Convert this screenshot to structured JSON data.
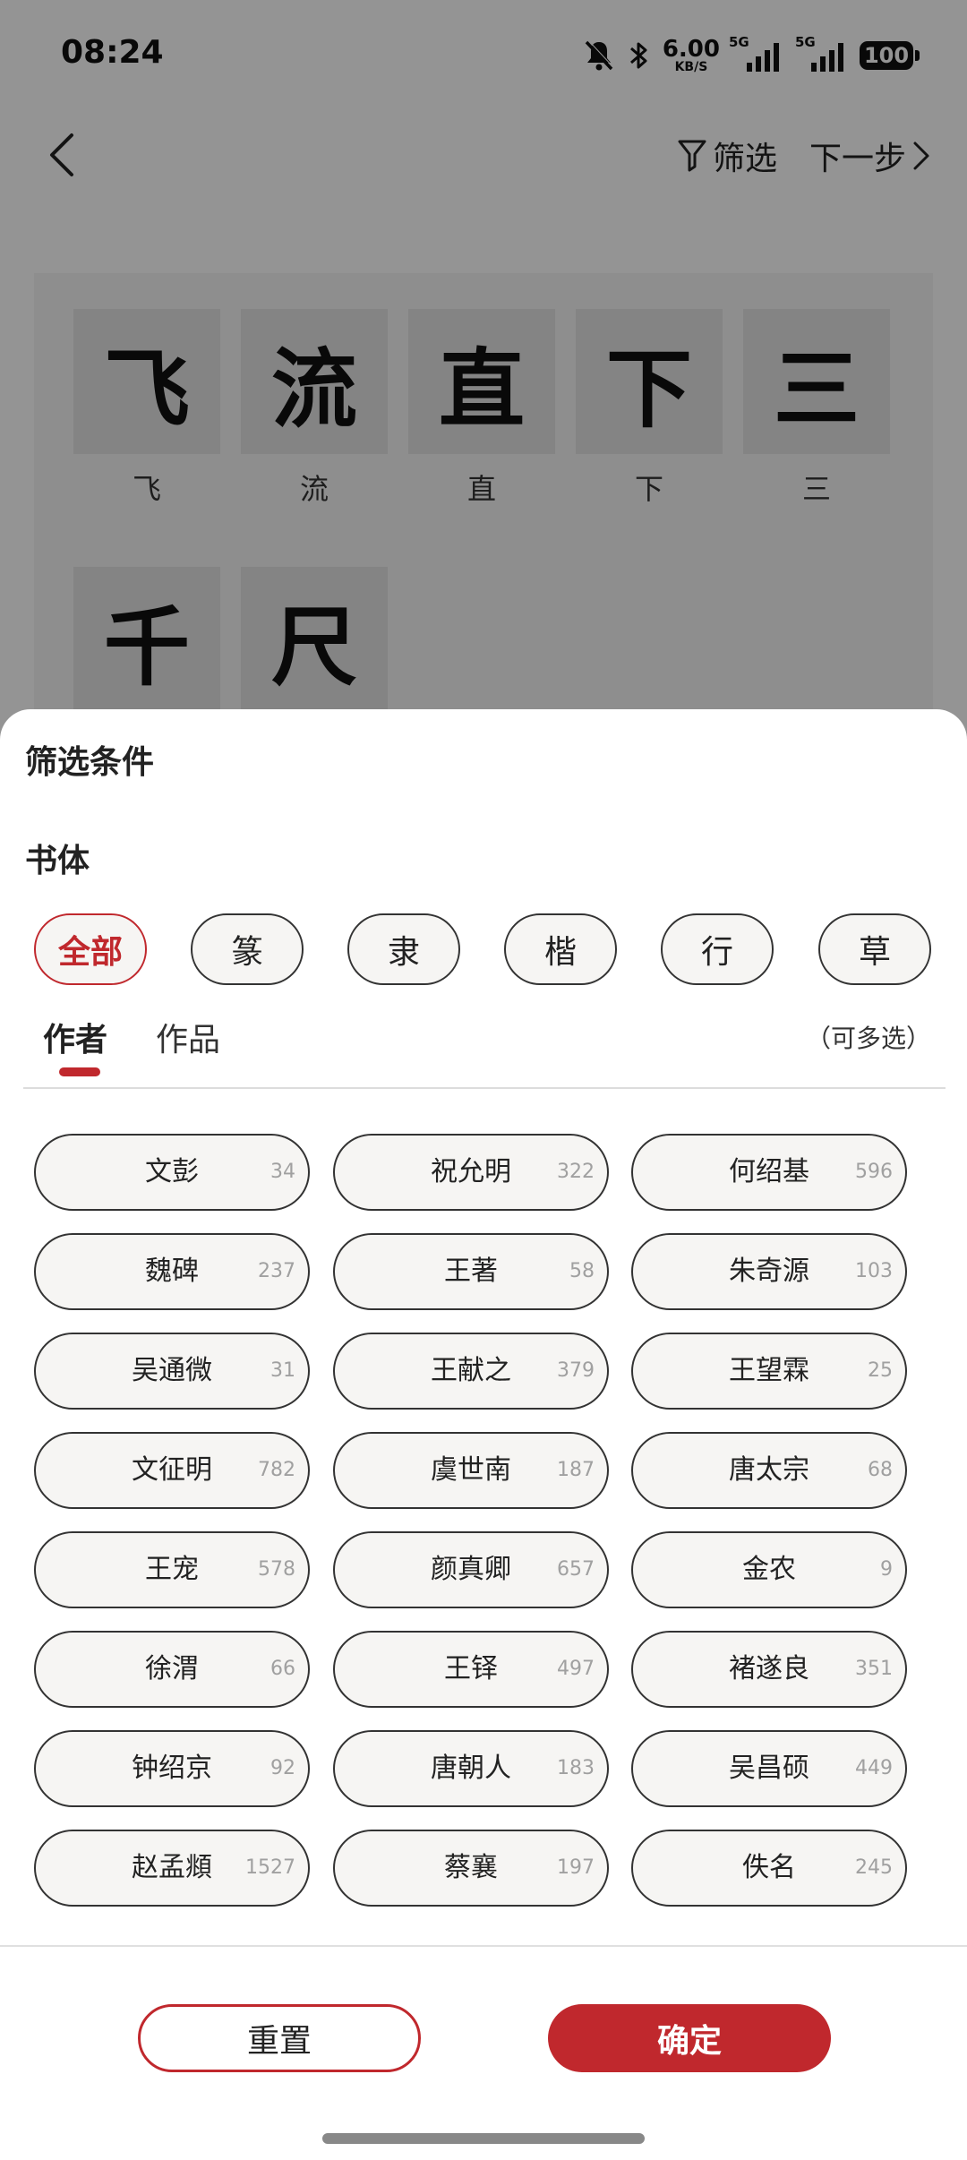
{
  "status_bar": {
    "time": "08:24",
    "net_speed": "6.00",
    "net_unit": "KB/S",
    "signal1_label": "5G",
    "signal2_label": "5G",
    "battery": "100"
  },
  "top_nav": {
    "filter_label": "筛选",
    "next_label": "下一步"
  },
  "characters": [
    {
      "glyph": "飞",
      "label": "飞"
    },
    {
      "glyph": "流",
      "label": "流"
    },
    {
      "glyph": "直",
      "label": "直"
    },
    {
      "glyph": "下",
      "label": "下"
    },
    {
      "glyph": "三",
      "label": "三"
    },
    {
      "glyph": "千",
      "label": ""
    },
    {
      "glyph": "尺",
      "label": ""
    }
  ],
  "sheet": {
    "title": "筛选条件",
    "script_section_title": "书体",
    "scripts": [
      {
        "label": "全部",
        "active": true
      },
      {
        "label": "篆",
        "active": false
      },
      {
        "label": "隶",
        "active": false
      },
      {
        "label": "楷",
        "active": false
      },
      {
        "label": "行",
        "active": false
      },
      {
        "label": "草",
        "active": false
      }
    ],
    "tabs": [
      {
        "label": "作者",
        "active": true
      },
      {
        "label": "作品",
        "active": false
      }
    ],
    "multi_hint": "（可多选）",
    "authors": [
      {
        "name": "文彭",
        "count": "34"
      },
      {
        "name": "祝允明",
        "count": "322"
      },
      {
        "name": "何绍基",
        "count": "596"
      },
      {
        "name": "魏碑",
        "count": "237"
      },
      {
        "name": "王著",
        "count": "58"
      },
      {
        "name": "朱奇源",
        "count": "103"
      },
      {
        "name": "吴通微",
        "count": "31"
      },
      {
        "name": "王献之",
        "count": "379"
      },
      {
        "name": "王望霖",
        "count": "25"
      },
      {
        "name": "文征明",
        "count": "782"
      },
      {
        "name": "虞世南",
        "count": "187"
      },
      {
        "name": "唐太宗",
        "count": "68"
      },
      {
        "name": "王宠",
        "count": "578"
      },
      {
        "name": "颜真卿",
        "count": "657"
      },
      {
        "name": "金农",
        "count": "9"
      },
      {
        "name": "徐渭",
        "count": "66"
      },
      {
        "name": "王铎",
        "count": "497"
      },
      {
        "name": "褚遂良",
        "count": "351"
      },
      {
        "name": "钟绍京",
        "count": "92"
      },
      {
        "name": "唐朝人",
        "count": "183"
      },
      {
        "name": "吴昌硕",
        "count": "449"
      },
      {
        "name": "赵孟頫",
        "count": "1527"
      },
      {
        "name": "蔡襄",
        "count": "197"
      },
      {
        "name": "佚名",
        "count": "245"
      }
    ],
    "reset_label": "重置",
    "confirm_label": "确定"
  },
  "colors": {
    "accent": "#c0282d",
    "pill_bg": "#f6f5f3",
    "overlay": "rgba(0,0,0,0.42)"
  },
  "icons": [
    "mute-icon",
    "bluetooth-icon",
    "signal-icon",
    "battery-icon",
    "back-arrow-icon",
    "filter-icon",
    "chevron-right-icon"
  ]
}
